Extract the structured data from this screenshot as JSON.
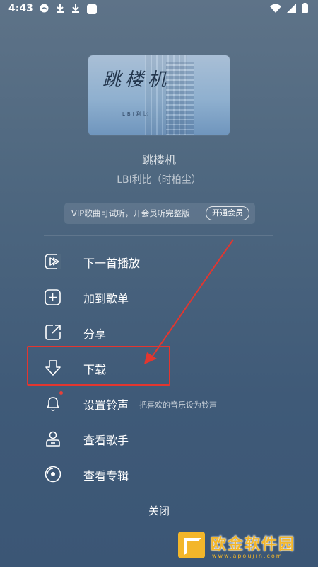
{
  "status_bar": {
    "time": "4:43",
    "left_icons": [
      "android-icon",
      "download-icon",
      "download-icon",
      "app-icon"
    ],
    "right_icons": [
      "wifi-icon",
      "signal-icon",
      "battery-icon"
    ]
  },
  "cover": {
    "title_art": "跳楼机",
    "subtitle_art": "LBI利比"
  },
  "song": {
    "title": "跳楼机",
    "artist": "LBI利比（时柏尘）"
  },
  "vip": {
    "text": "VIP歌曲可试听，开会员听完整版",
    "button": "开通会员"
  },
  "menu": [
    {
      "label": "下一首播放",
      "icon": "play-next-icon"
    },
    {
      "label": "加到歌单",
      "icon": "add-to-playlist-icon"
    },
    {
      "label": "分享",
      "icon": "share-icon"
    },
    {
      "label": "下载",
      "icon": "download-icon"
    },
    {
      "label": "设置铃声",
      "icon": "bell-icon",
      "hint": "把喜欢的音乐设为铃声"
    },
    {
      "label": "查看歌手",
      "icon": "person-icon"
    },
    {
      "label": "查看专辑",
      "icon": "album-icon"
    }
  ],
  "close_label": "关闭",
  "annotation_color": "#e3362f",
  "watermark": {
    "title": "欧金软件园",
    "url": "www.apoujin.com",
    "color": "#f3b62a"
  }
}
